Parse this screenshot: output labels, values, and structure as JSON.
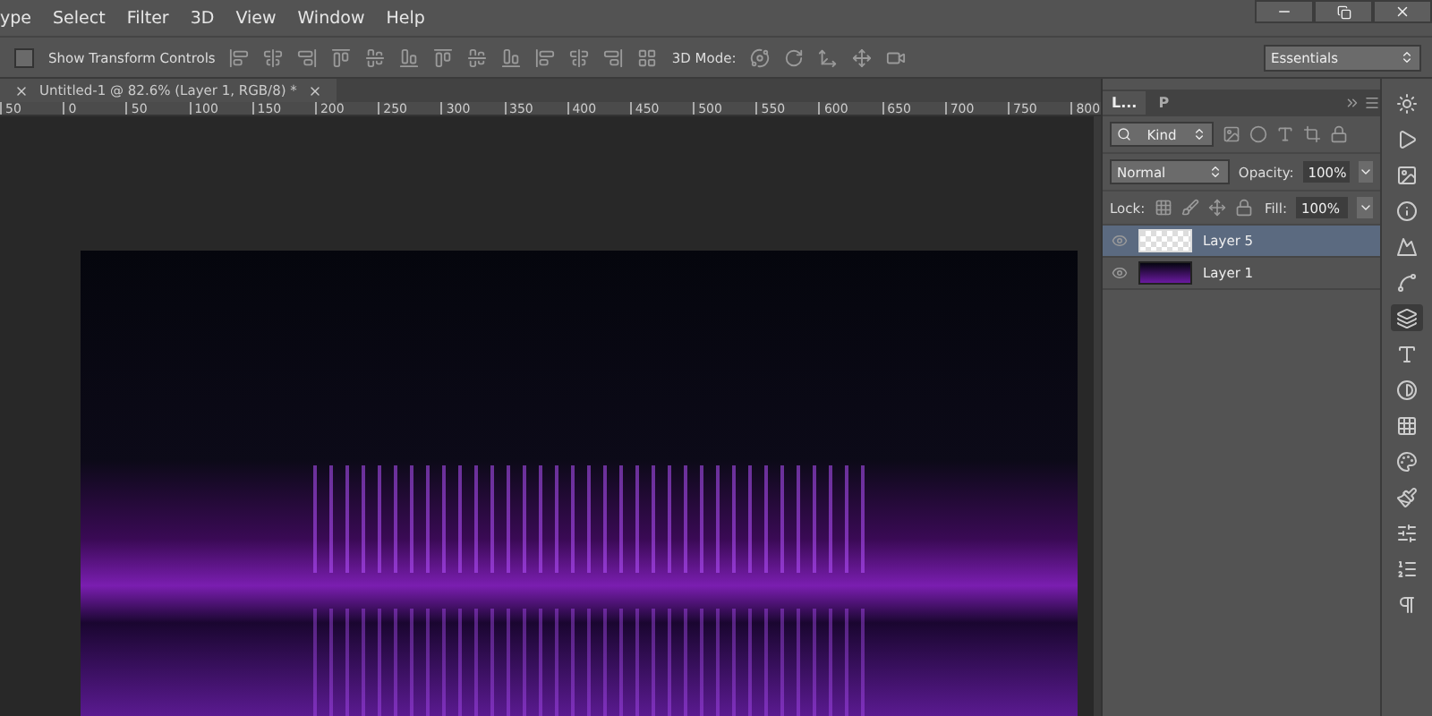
{
  "menu": [
    "ype",
    "Select",
    "Filter",
    "3D",
    "View",
    "Window",
    "Help"
  ],
  "options_bar": {
    "show_transform_controls": {
      "label": "Show Transform Controls",
      "checked": false
    },
    "mode_label": "3D Mode:",
    "workspace": "Essentials"
  },
  "document_tab": {
    "title": "Untitled-1 @ 82.6% (Layer 1, RGB/8) *"
  },
  "ruler": [
    "50",
    "0",
    "50",
    "100",
    "150",
    "200",
    "250",
    "300",
    "350",
    "400",
    "450",
    "500",
    "550",
    "600",
    "650",
    "700",
    "750",
    "800"
  ],
  "panel_tabs": [
    {
      "label": "L...",
      "selected": true
    },
    {
      "label": "P",
      "selected": false
    }
  ],
  "layers_panel": {
    "filter": "Kind",
    "blend_mode": "Normal",
    "opacity_label": "Opacity:",
    "opacity": "100%",
    "lock_label": "Lock:",
    "fill_label": "Fill:",
    "fill": "100%",
    "layers": [
      {
        "name": "Layer 5",
        "visible": true,
        "selected": true,
        "kind": "transparent"
      },
      {
        "name": "Layer 1",
        "visible": true,
        "selected": false,
        "kind": "photo"
      }
    ]
  }
}
